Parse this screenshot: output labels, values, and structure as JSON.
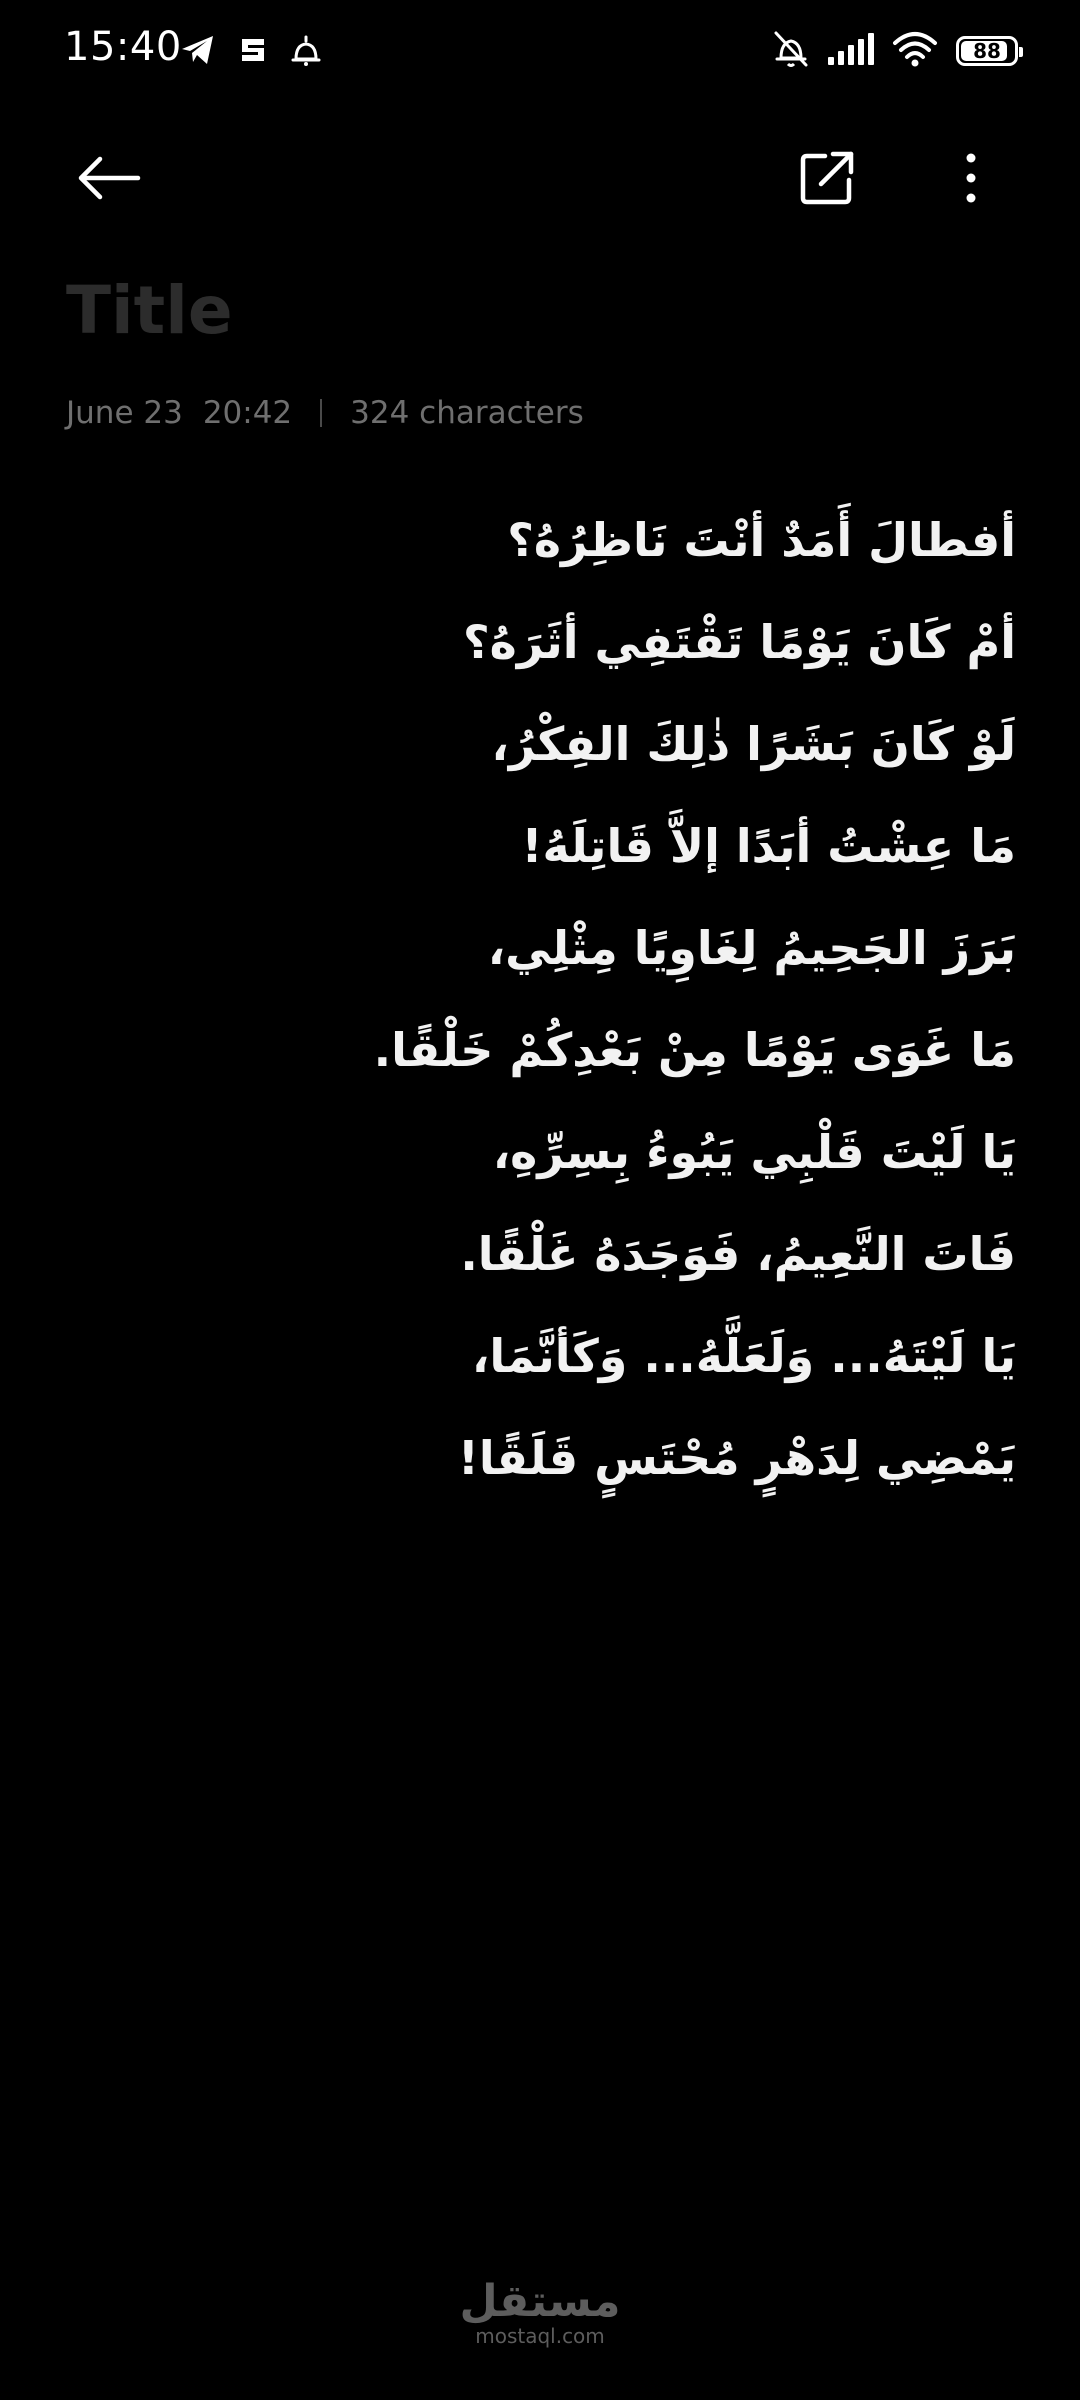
{
  "status_bar": {
    "time": "15:40",
    "left_icons": [
      "telegram-icon",
      "app-notification-icon",
      "alarm-bell-icon"
    ],
    "right_icons": [
      "bell-muted-icon",
      "signal-icon",
      "wifi-icon",
      "battery-icon"
    ],
    "battery_level": "88",
    "battery_fraction": 0.88
  },
  "toolbar": {
    "back_icon": "arrow-left-icon",
    "share_icon": "share-external-icon",
    "more_icon": "more-vertical-icon"
  },
  "note": {
    "title_placeholder": "Title",
    "date": "June 23",
    "time": "20:42",
    "char_count": "324 characters",
    "lines": [
      "أفطالَ أَمَدٌ أنْتَ نَاظِرُهُ؟",
      "أمْ كَانَ يَوْمًا تَقْتَفِي أثَرَهُ؟",
      "لَوْ كَانَ بَشَرًا ذٰلِكَ الفِكْرُ،",
      "مَا عِشْتُ أبَدًا إلاَّ قَاتِلَهُ!",
      "بَرَزَ الجَحِيمُ لِغَاوِيًا مِثْلِي،",
      "مَا غَوَى يَوْمًا مِنْ بَعْدِكُمْ خَلْقًا.",
      "يَا لَيْتَ قَلْبِي يَبُوءُ بِسِرِّهِ،",
      "فَاتَ النَّعِيمُ، فَوَجَدَهُ غَلْقًا.",
      "يَا لَيْتَهُ... وَلَعَلَّهُ... وَكَأنَّمَا،",
      "يَمْضِي لِدَهْرٍ مُحْتَسٍ قَلَقًا!"
    ]
  },
  "watermark": {
    "main": "مستقل",
    "sub": "mostaql.com"
  },
  "colors": {
    "background": "#000000",
    "text": "#f2f2f2",
    "title_placeholder": "#2c2c2c",
    "meta": "#6f6f6f"
  }
}
